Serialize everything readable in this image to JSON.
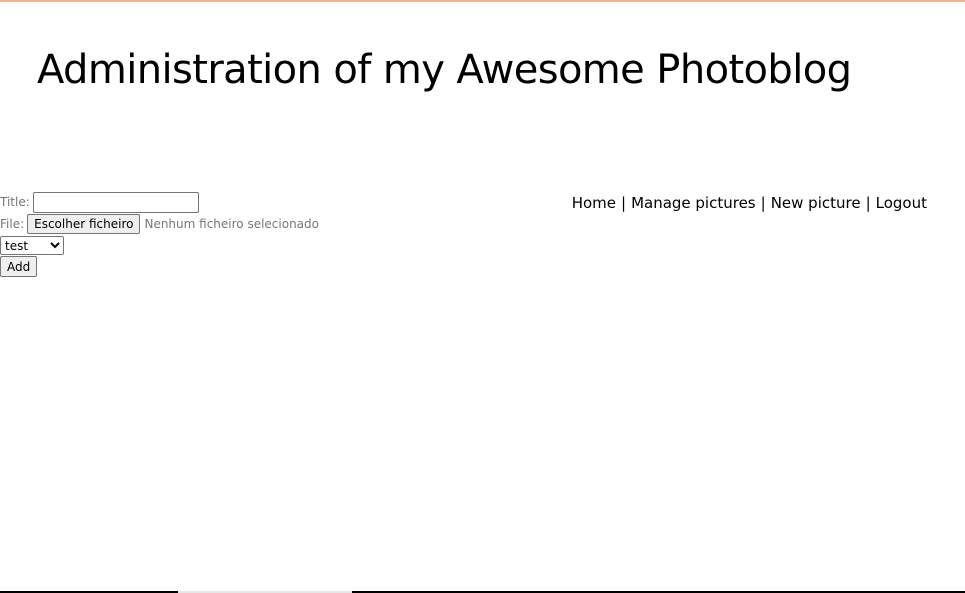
{
  "page": {
    "title": "Administration of my Awesome Photoblog"
  },
  "nav": {
    "items": [
      {
        "label": "Home"
      },
      {
        "label": "Manage pictures"
      },
      {
        "label": "New picture"
      },
      {
        "label": "Logout"
      }
    ],
    "separator": "|"
  },
  "form": {
    "title_label": "Title:",
    "title_value": "",
    "file_label": "File:",
    "file_button_label": "Escolher ficheiro",
    "file_status": "Nenhum ficheiro selecionado",
    "category_selected": "test",
    "add_button_label": "Add"
  },
  "colors": {
    "top_border": "#f0b48a",
    "label_text": "#777777",
    "button_background": "#efefef"
  }
}
